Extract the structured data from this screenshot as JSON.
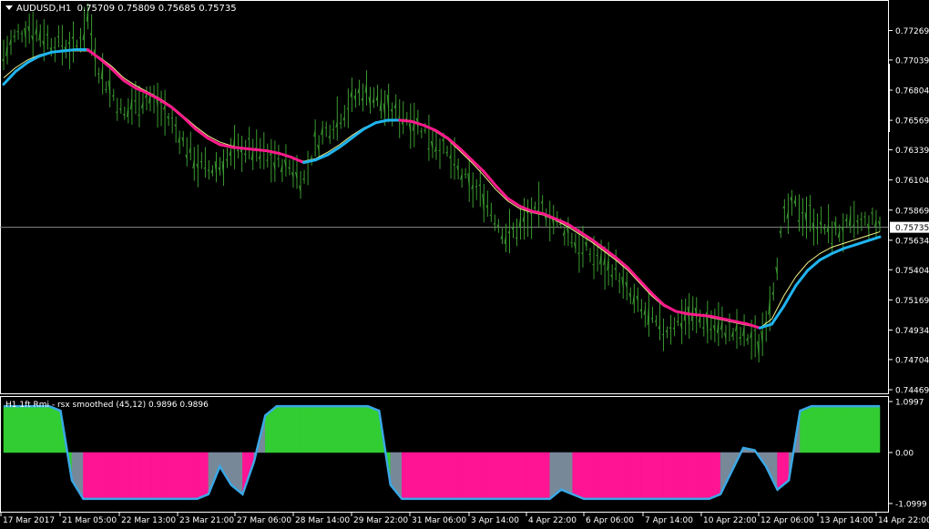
{
  "header": {
    "symbol": "AUDUSD,H1",
    "ohlc": "0.75709 0.75809 0.75685 0.75735"
  },
  "subwindow": {
    "label": "H1 1ft Rmi - rsx smoothed (45,12) 0.9896 0.9896"
  },
  "colors": {
    "background": "#000000",
    "candles": "#3a9a30",
    "ma_up": "#1fb4f0",
    "ma_down": "#ff1a8c",
    "ma_slow": "#f0f08a",
    "fill_up": "#32cd32",
    "fill_down": "#ff1493",
    "fill_neutral": "#778899",
    "osc_line": "#3aa8e6",
    "axis": "#ffffff"
  },
  "chart_data": [
    {
      "type": "line",
      "title": "AUDUSD,H1",
      "ylim": [
        0.74469,
        0.7745
      ],
      "price_ticks": [
        0.77269,
        0.77039,
        0.76804,
        0.76569,
        0.76339,
        0.76104,
        0.75869,
        0.75634,
        0.75404,
        0.75169,
        0.74934,
        0.74704,
        0.74469
      ],
      "current_price": 0.75735,
      "time_labels": [
        "17 Mar 2017",
        "21 Mar 05:00",
        "22 Mar 13:00",
        "23 Mar 21:00",
        "27 Mar 06:00",
        "28 Mar 14:00",
        "29 Mar 22:00",
        "31 Mar 06:00",
        "3 Apr 14:00",
        "4 Apr 22:00",
        "6 Apr 06:00",
        "7 Apr 14:00",
        "10 Apr 22:00",
        "12 Apr 06:00",
        "13 Apr 14:00",
        "14 Apr 22:00"
      ],
      "price_path": [
        0.7708,
        0.7722,
        0.773,
        0.7725,
        0.7718,
        0.7716,
        0.7712,
        0.7738,
        0.7695,
        0.768,
        0.766,
        0.7672,
        0.7675,
        0.7668,
        0.7655,
        0.764,
        0.7625,
        0.7618,
        0.7622,
        0.763,
        0.7636,
        0.7632,
        0.7628,
        0.7624,
        0.762,
        0.761,
        0.764,
        0.765,
        0.766,
        0.7672,
        0.768,
        0.7675,
        0.7665,
        0.7662,
        0.7658,
        0.765,
        0.764,
        0.763,
        0.7615,
        0.7605,
        0.7598,
        0.758,
        0.7565,
        0.7575,
        0.7582,
        0.7588,
        0.7578,
        0.757,
        0.7558,
        0.7552,
        0.7545,
        0.754,
        0.7522,
        0.751,
        0.75,
        0.7492,
        0.75,
        0.7505,
        0.7502,
        0.7498,
        0.7495,
        0.749,
        0.7488,
        0.7482,
        0.752,
        0.758,
        0.759,
        0.7582,
        0.7575,
        0.757,
        0.7572,
        0.7575,
        0.7578,
        0.7576
      ],
      "ma_fast": [
        0.7685,
        0.7695,
        0.7702,
        0.7707,
        0.771,
        0.7711,
        0.7712,
        0.7712,
        0.7705,
        0.7697,
        0.7688,
        0.7682,
        0.7678,
        0.7673,
        0.7667,
        0.7659,
        0.765,
        0.7643,
        0.7638,
        0.7636,
        0.7635,
        0.7634,
        0.7633,
        0.7631,
        0.7628,
        0.7624,
        0.7626,
        0.763,
        0.7636,
        0.7643,
        0.765,
        0.7655,
        0.7657,
        0.7657,
        0.7656,
        0.7653,
        0.7649,
        0.7643,
        0.7635,
        0.7626,
        0.7617,
        0.7606,
        0.7596,
        0.759,
        0.7586,
        0.7584,
        0.758,
        0.7576,
        0.757,
        0.7564,
        0.7557,
        0.755,
        0.7542,
        0.7532,
        0.7522,
        0.7513,
        0.7508,
        0.7506,
        0.7505,
        0.7504,
        0.7502,
        0.75,
        0.7498,
        0.7495,
        0.7498,
        0.7512,
        0.7528,
        0.754,
        0.7548,
        0.7553,
        0.7557,
        0.756,
        0.7563,
        0.7566
      ],
      "ma_slow": [
        0.769,
        0.7698,
        0.7704,
        0.7708,
        0.771,
        0.7711,
        0.7711,
        0.7711,
        0.7706,
        0.7699,
        0.769,
        0.7684,
        0.7679,
        0.7674,
        0.7668,
        0.766,
        0.7652,
        0.7645,
        0.764,
        0.7637,
        0.7635,
        0.7634,
        0.7633,
        0.7631,
        0.7628,
        0.7625,
        0.7627,
        0.7632,
        0.7638,
        0.7645,
        0.7651,
        0.7655,
        0.7657,
        0.7657,
        0.7656,
        0.7653,
        0.7648,
        0.7642,
        0.7633,
        0.7624,
        0.7614,
        0.7603,
        0.7594,
        0.7588,
        0.7585,
        0.7583,
        0.7579,
        0.7574,
        0.7568,
        0.7562,
        0.7555,
        0.7548,
        0.754,
        0.753,
        0.752,
        0.7512,
        0.7508,
        0.7506,
        0.7505,
        0.7503,
        0.7501,
        0.7499,
        0.7497,
        0.7495,
        0.7502,
        0.752,
        0.7535,
        0.7546,
        0.7553,
        0.7558,
        0.7561,
        0.7564,
        0.7567,
        0.757
      ]
    },
    {
      "type": "area",
      "title": "H1 1ft Rmi - rsx smoothed (45,12) 0.9896 0.9896",
      "ylim": [
        -1.0999,
        1.0997
      ],
      "ticks": [
        1.0997,
        0.0,
        -1.0999
      ],
      "values": [
        1.0,
        1.0,
        1.0,
        1.0,
        1.0,
        0.9,
        -0.6,
        -1.0,
        -1.0,
        -1.0,
        -1.0,
        -1.0,
        -1.0,
        -1.0,
        -1.0,
        -1.0,
        -1.0,
        -1.0,
        -0.9,
        -0.3,
        -0.7,
        -0.9,
        -0.2,
        0.8,
        1.0,
        1.0,
        1.0,
        1.0,
        1.0,
        1.0,
        1.0,
        1.0,
        1.0,
        0.9,
        -0.7,
        -1.0,
        -1.0,
        -1.0,
        -1.0,
        -1.0,
        -1.0,
        -1.0,
        -1.0,
        -1.0,
        -1.0,
        -1.0,
        -1.0,
        -1.0,
        -1.0,
        -0.8,
        -0.9,
        -1.0,
        -1.0,
        -1.0,
        -1.0,
        -1.0,
        -1.0,
        -1.0,
        -1.0,
        -1.0,
        -1.0,
        -1.0,
        -1.0,
        -0.9,
        -0.4,
        0.1,
        0.05,
        -0.3,
        -0.8,
        -0.6,
        0.9,
        1.0,
        1.0,
        1.0,
        1.0,
        1.0,
        1.0,
        1.0
      ],
      "state": [
        "u",
        "u",
        "u",
        "u",
        "u",
        "u",
        "n",
        "d",
        "d",
        "d",
        "d",
        "d",
        "d",
        "d",
        "d",
        "d",
        "d",
        "d",
        "n",
        "n",
        "n",
        "d",
        "n",
        "u",
        "u",
        "u",
        "u",
        "u",
        "u",
        "u",
        "u",
        "u",
        "u",
        "u",
        "n",
        "d",
        "d",
        "d",
        "d",
        "d",
        "d",
        "d",
        "d",
        "d",
        "d",
        "d",
        "d",
        "d",
        "n",
        "n",
        "d",
        "d",
        "d",
        "d",
        "d",
        "d",
        "d",
        "d",
        "d",
        "d",
        "d",
        "d",
        "d",
        "n",
        "n",
        "n",
        "n",
        "n",
        "d",
        "n",
        "u",
        "u",
        "u",
        "u",
        "u",
        "u",
        "u",
        "u"
      ]
    }
  ]
}
